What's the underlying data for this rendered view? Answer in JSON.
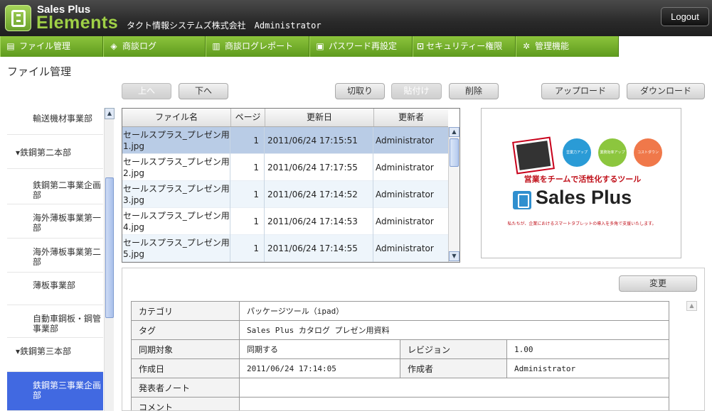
{
  "header": {
    "brand_top": "Sales Plus",
    "brand_bottom": "Elements",
    "company": "タクト情報システムズ株式会社　Administrator",
    "logout_label": "Logout"
  },
  "nav": {
    "items": [
      {
        "label": "ファイル管理",
        "icon": "document-icon"
      },
      {
        "label": "商談ログ",
        "icon": "tag-icon"
      },
      {
        "label": "商談ログレポート",
        "icon": "bar-chart-icon"
      },
      {
        "label": "パスワード再設定",
        "icon": "id-card-icon"
      },
      {
        "label": "セキュリティー権限",
        "icon": "lock-icon"
      },
      {
        "label": "管理機能",
        "icon": "gear-icon"
      }
    ]
  },
  "page": {
    "title": "ファイル管理"
  },
  "toolbar": {
    "up_label": "上へ",
    "down_label": "下へ",
    "cut_label": "切取り",
    "paste_label": "貼付け",
    "delete_label": "削除",
    "upload_label": "アップロード",
    "download_label": "ダウンロード"
  },
  "sidebar": {
    "items": [
      {
        "label": "輸送機材事業部",
        "type": "child"
      },
      {
        "label": "▾鉄鋼第二本部",
        "type": "group"
      },
      {
        "label": "鉄鋼第二事業企画部",
        "type": "child"
      },
      {
        "label": "海外薄板事業第一部",
        "type": "child"
      },
      {
        "label": "海外薄板事業第二部",
        "type": "child"
      },
      {
        "label": "薄板事業部",
        "type": "child"
      },
      {
        "label": "自動車鋼板・鋼管事業部",
        "type": "child"
      },
      {
        "label": "▾鉄鋼第三本部",
        "type": "group"
      },
      {
        "label": "鉄鋼第三事業企画部",
        "type": "child",
        "selected": true
      }
    ]
  },
  "file_table": {
    "columns": [
      "ファイル名",
      "ページ",
      "更新日",
      "更新者"
    ],
    "rows": [
      {
        "name": "セールスプラス_プレゼン用1.jpg",
        "pages": "1",
        "updated": "2011/06/24 17:15:51",
        "user": "Administrator"
      },
      {
        "name": "セールスプラス_プレゼン用2.jpg",
        "pages": "1",
        "updated": "2011/06/24 17:17:55",
        "user": "Administrator"
      },
      {
        "name": "セールスプラス_プレゼン用3.jpg",
        "pages": "1",
        "updated": "2011/06/24 17:14:52",
        "user": "Administrator"
      },
      {
        "name": "セールスプラス_プレゼン用4.jpg",
        "pages": "1",
        "updated": "2011/06/24 17:14:53",
        "user": "Administrator"
      },
      {
        "name": "セールスプラス_プレゼン用5.jpg",
        "pages": "1",
        "updated": "2011/06/24 17:14:55",
        "user": "Administrator"
      }
    ]
  },
  "preview": {
    "badges": [
      "営業力アップ",
      "業務効率アップ",
      "コストダウン"
    ],
    "slogan": "営業をチームで活性化するツール",
    "brand": "Sales Plus",
    "footnote": "私たちが、企業におけるスマートタブレットの導入を多角で支援いたします。"
  },
  "detail": {
    "change_label": "変更",
    "category_label": "カテゴリ",
    "category_value": "パッケージツール（ipad）",
    "tag_label": "タグ",
    "tag_value": "Sales Plus カタログ プレゼン用資料",
    "sync_label": "同期対象",
    "sync_value": "同期する",
    "revision_label": "レビジョン",
    "revision_value": "1.00",
    "created_label": "作成日",
    "created_value": "2011/06/24 17:14:05",
    "author_label": "作成者",
    "author_value": "Administrator",
    "presenter_note_label": "発表者ノート",
    "presenter_note_value": "",
    "comment_label": "コメント",
    "comment_value": ""
  },
  "colors": {
    "nav_green": "#6aa52a",
    "brand_green": "#9fd046",
    "selected_blue": "#4169e1",
    "row_selected": "#b9cce6"
  }
}
